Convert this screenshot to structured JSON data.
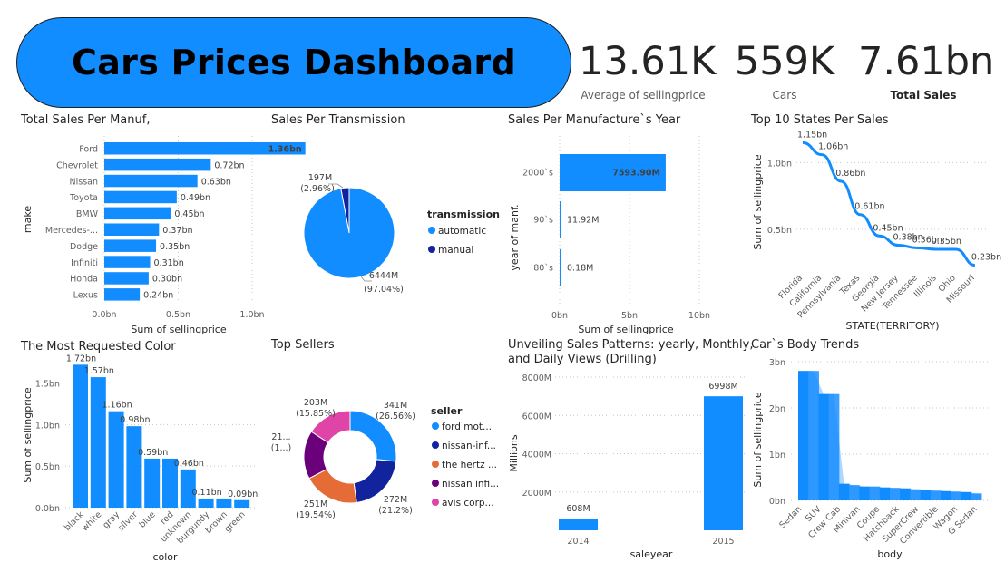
{
  "header": {
    "title": "Cars Prices Dashboard"
  },
  "kpis": [
    {
      "value": "13.61K",
      "label": "Average of sellingprice"
    },
    {
      "value": "559K",
      "label": "Cars"
    },
    {
      "value": "7.61bn",
      "label": "Total Sales"
    }
  ],
  "colors": {
    "primary": "#118dff",
    "dark": "#12239e",
    "orange": "#e66c37",
    "purple": "#6b007b",
    "pink": "#e044a7",
    "banner": "#118dff"
  },
  "chart_data": [
    {
      "id": "manuf",
      "type": "bar",
      "orientation": "horizontal",
      "title": "Total Sales Per Manuf,",
      "categories": [
        "Ford",
        "Chevrolet",
        "Nissan",
        "Toyota",
        "BMW",
        "Mercedes-...",
        "Dodge",
        "Infiniti",
        "Honda",
        "Lexus"
      ],
      "values": [
        1.36,
        0.72,
        0.63,
        0.49,
        0.45,
        0.37,
        0.35,
        0.31,
        0.3,
        0.24
      ],
      "labels": [
        "1.36bn",
        "0.72bn",
        "0.63bn",
        "0.49bn",
        "0.45bn",
        "0.37bn",
        "0.35bn",
        "0.31bn",
        "0.30bn",
        "0.24bn"
      ],
      "xlabel": "Sum of sellingprice",
      "ylabel": "make",
      "xticks": [
        "0.0bn",
        "0.5bn",
        "1.0bn"
      ],
      "xlim": [
        0,
        1.0
      ]
    },
    {
      "id": "transmission",
      "type": "pie",
      "title": "Sales Per Transmission",
      "legend_title": "transmission",
      "slices": [
        {
          "name": "automatic",
          "value": 6444,
          "label1": "6444M",
          "label2": "(97.04%)"
        },
        {
          "name": "manual",
          "value": 197,
          "label1": "197M",
          "label2": "(2.96%)"
        }
      ]
    },
    {
      "id": "year",
      "type": "bar",
      "orientation": "horizontal",
      "title": "Sales Per Manufacture`s Year",
      "categories": [
        "2000`s",
        "90`s",
        "80`s"
      ],
      "values": [
        7593.9,
        11.92,
        0.18
      ],
      "labels": [
        "7593.90M",
        "11.92M",
        "0.18M"
      ],
      "xlabel": "Sum of sellingprice",
      "ylabel": "year of manf.",
      "xticks": [
        "0bn",
        "5bn",
        "10bn"
      ],
      "xlim": [
        0,
        10000
      ]
    },
    {
      "id": "states",
      "type": "line",
      "title": "Top 10 States Per Sales",
      "categories": [
        "Florida",
        "California",
        "Pennsylvania",
        "Texas",
        "Georgia",
        "New Jersey",
        "Tennessee",
        "Illinois",
        "Ohio",
        "Missouri"
      ],
      "values": [
        1.15,
        1.06,
        0.86,
        0.61,
        0.45,
        0.38,
        0.36,
        0.35,
        0.35,
        0.23
      ],
      "labels": [
        "1.15bn",
        "1.06bn",
        "0.86bn",
        "0.61bn",
        "0.45bn",
        "0.38bn",
        "0.36bn",
        "0.35bn",
        "",
        "0.23bn"
      ],
      "xlabel": "STATE(TERRITORY)",
      "ylabel": "Sum of sellingprice",
      "yticks": [
        "1.0bn",
        "0.5bn"
      ],
      "ylim": [
        0.2,
        1.2
      ]
    },
    {
      "id": "color",
      "type": "bar",
      "title": "The Most Requested Color",
      "categories": [
        "black",
        "white",
        "gray",
        "silver",
        "blue",
        "red",
        "unknown",
        "burgundy",
        "brown",
        "green"
      ],
      "values": [
        1.72,
        1.57,
        1.16,
        0.98,
        0.59,
        0.59,
        0.46,
        0.11,
        0.11,
        0.09
      ],
      "labels": [
        "1.72bn",
        "1.57bn",
        "1.16bn",
        "0.98bn",
        "0.59bn",
        "",
        "0.46bn",
        "0.11bn",
        "",
        "0.09bn"
      ],
      "xlabel": "color",
      "ylabel": "Sum of sellingprice",
      "yticks": [
        "0.0bn",
        "0.5bn",
        "1.0bn",
        "1.5bn"
      ],
      "ylim": [
        0,
        1.8
      ]
    },
    {
      "id": "sellers",
      "type": "pie",
      "donut": true,
      "title": "Top Sellers",
      "legend_title": "seller",
      "slices": [
        {
          "name": "ford mot...",
          "value": 341,
          "label1": "341M",
          "label2": "(26.56%)"
        },
        {
          "name": "nissan-inf...",
          "value": 272,
          "label1": "272M",
          "label2": "(21.2%)"
        },
        {
          "name": "the hertz ...",
          "value": 251,
          "label1": "251M",
          "label2": "(19.54%)"
        },
        {
          "name": "nissan infi...",
          "value": 217,
          "label1": "21...",
          "label2": "(1...)"
        },
        {
          "name": "avis corp...",
          "value": 203,
          "label1": "203M",
          "label2": "(15.85%)"
        }
      ]
    },
    {
      "id": "saleyear",
      "type": "bar",
      "title": "Unveiling Sales Patterns: yearly, Monthly, and Daily Views (Drilling)",
      "title_lines": [
        "Unveiling Sales Patterns: yearly, Monthly,",
        "and Daily Views (Drilling)"
      ],
      "categories": [
        "2014",
        "2015"
      ],
      "values": [
        608,
        6998
      ],
      "labels": [
        "608M",
        "6998M"
      ],
      "xlabel": "saleyear",
      "ylabel": "Millions",
      "yticks": [
        "2000M",
        "4000M",
        "6000M",
        "8000M"
      ],
      "ylim": [
        0,
        8500
      ]
    },
    {
      "id": "body",
      "type": "area",
      "title": "Car`s Body Trends",
      "categories": [
        "Sedan",
        "SUV",
        "Crew Cab",
        "Minivan",
        "Coupe",
        "Hatchback",
        "SuperCrew",
        "Convertible",
        "Wagon",
        "G Sedan"
      ],
      "values": [
        2.8,
        2.3,
        0.36,
        0.3,
        0.28,
        0.26,
        0.22,
        0.2,
        0.18,
        0.15
      ],
      "xlabel": "body",
      "ylabel": "Sum of sellingprice",
      "yticks": [
        "0bn",
        "1bn",
        "2bn",
        "3bn"
      ],
      "ylim": [
        0,
        3
      ]
    }
  ]
}
